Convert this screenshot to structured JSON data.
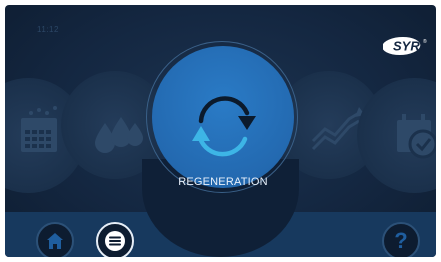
{
  "status": {
    "time": "11:12"
  },
  "brand": {
    "logo_text": "SYR",
    "registered_mark": "®"
  },
  "main": {
    "center_label": "REGENERATION"
  },
  "nav": {
    "help_label": "?"
  },
  "colors": {
    "background": "#142741",
    "accent_blue": "#2369b0",
    "regeneration_arrow_light": "#3db5e6",
    "regeneration_arrow_dark": "#0b1a2c",
    "bottom_bar": "#17395e"
  },
  "icons": {
    "menu_left_1": "calendar-dots-icon",
    "menu_left_2": "water-drops-icon",
    "menu_right_1": "line-chart-icon",
    "menu_right_2": "calendar-check-icon",
    "home": "home-icon",
    "menu": "hamburger-menu-icon",
    "help": "question-icon"
  }
}
